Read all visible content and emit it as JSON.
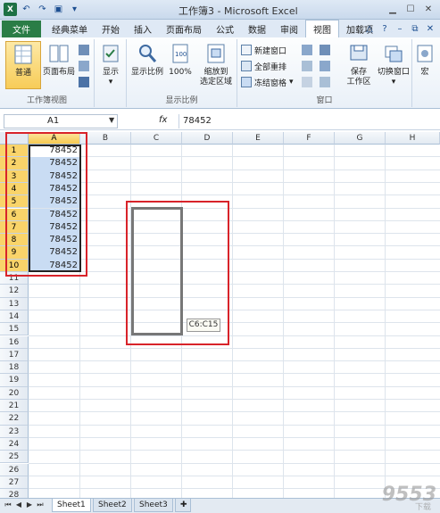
{
  "titlebar": {
    "title": "工作簿3 - Microsoft Excel",
    "logo": "X"
  },
  "tabs": [
    {
      "label": "文件",
      "kind": "file"
    },
    {
      "label": "经典菜单"
    },
    {
      "label": "开始"
    },
    {
      "label": "插入"
    },
    {
      "label": "页面布局"
    },
    {
      "label": "公式"
    },
    {
      "label": "数据"
    },
    {
      "label": "审阅"
    },
    {
      "label": "视图",
      "active": true
    },
    {
      "label": "加载项"
    }
  ],
  "ribbon": {
    "groups": {
      "workbook_views": "工作簿视图",
      "zoom": "显示比例",
      "window": "窗口"
    },
    "buttons": {
      "normal": "普通",
      "page_layout": "页面布局",
      "show": "显示",
      "zoom": "显示比例",
      "zoom100": "100%",
      "zoom_selection": "缩放到\n选定区域",
      "new_window": "新建窗口",
      "arrange_all": "全部重排",
      "freeze_panes": "冻结窗格",
      "save_workspace": "保存\n工作区",
      "switch_window": "切换窗口",
      "macros": "宏"
    }
  },
  "formula_bar": {
    "name_box": "A1",
    "fx": "fx",
    "value": "78452"
  },
  "grid": {
    "columns": [
      "A",
      "B",
      "C",
      "D",
      "E",
      "F",
      "G",
      "H"
    ],
    "rows": [
      "1",
      "2",
      "3",
      "4",
      "5",
      "6",
      "7",
      "8",
      "9",
      "10",
      "11",
      "12",
      "13",
      "14",
      "15",
      "16",
      "17",
      "18",
      "19",
      "20",
      "21",
      "22",
      "23",
      "24",
      "25",
      "26",
      "27",
      "28"
    ],
    "a_values": [
      "78452",
      "78452",
      "78452",
      "78452",
      "78452",
      "78452",
      "78452",
      "78452",
      "78452",
      "78452"
    ],
    "drag_tooltip": "C6:C15"
  },
  "sheets": [
    {
      "label": "Sheet1",
      "active": true
    },
    {
      "label": "Sheet2"
    },
    {
      "label": "Sheet3"
    }
  ],
  "watermark": {
    "text": "9553",
    "suffix": "下载"
  },
  "colors": {
    "file_tab": "#2a7d46",
    "highlight": "#d8232a",
    "selection_fill": "#c9dcf3"
  }
}
